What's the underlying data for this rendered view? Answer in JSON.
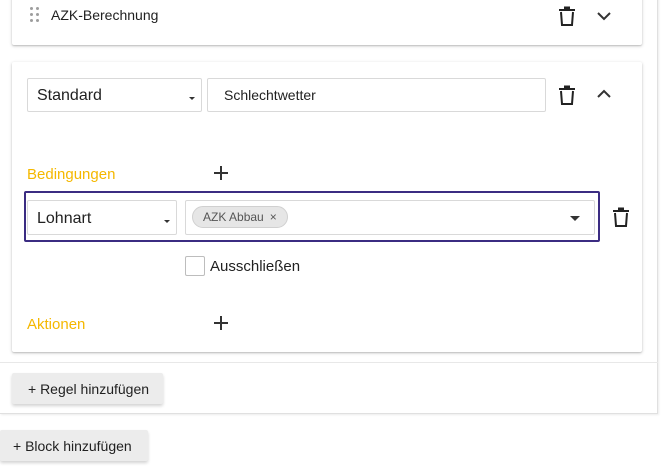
{
  "block": {
    "rule1": {
      "title": "AZK-Berechnung",
      "icons": {
        "drag": "drag-handle-icon",
        "delete": "trash-icon",
        "toggle": "chevron-down-icon"
      }
    },
    "rule2": {
      "type_select": {
        "value": "Standard"
      },
      "name_input": {
        "value": "Schlechtwetter"
      },
      "icons": {
        "delete": "trash-icon",
        "toggle": "chevron-up-icon"
      },
      "conditions": {
        "label": "Bedingungen",
        "add_icon": "plus-icon",
        "items": [
          {
            "field_select": {
              "value": "Lohnart"
            },
            "values": [
              {
                "label": "AZK Abbau",
                "remove": "×"
              }
            ],
            "exclude_label": "Ausschließen",
            "exclude_checked": false,
            "delete_icon": "trash-icon"
          }
        ]
      },
      "actions": {
        "label": "Aktionen",
        "add_icon": "plus-icon"
      }
    },
    "add_rule_label": "+ Regel hinzufügen"
  },
  "add_block_label": "+ Block hinzufügen",
  "colors": {
    "section_label": "#f5b800",
    "focus_border": "#3b2c82"
  }
}
